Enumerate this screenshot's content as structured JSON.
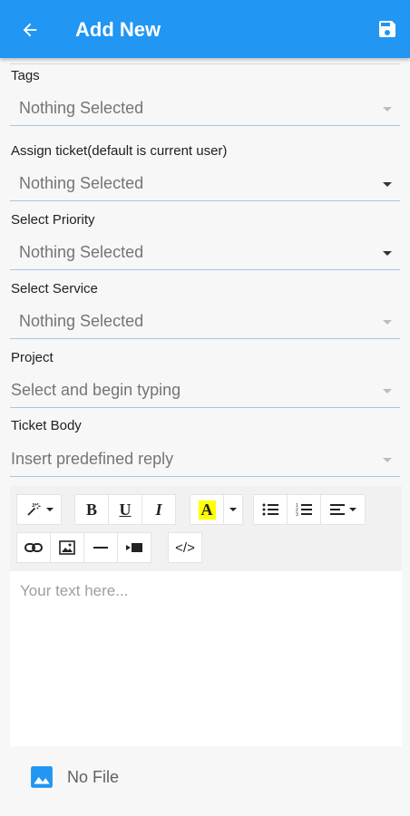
{
  "header": {
    "title": "Add New"
  },
  "fields": {
    "tags": {
      "label": "Tags",
      "value": "Nothing Selected"
    },
    "assign": {
      "label": "Assign ticket(default is current user)",
      "value": "Nothing Selected"
    },
    "priority": {
      "label": "Select Priority",
      "value": "Nothing Selected"
    },
    "service": {
      "label": "Select Service",
      "value": "Nothing Selected"
    },
    "project": {
      "label": "Project",
      "value": "Select and begin typing"
    },
    "ticket_body": {
      "label": "Ticket Body",
      "value": "Insert predefined reply"
    }
  },
  "editor": {
    "toolbar": {
      "bold": "B",
      "underline": "U",
      "italic": "I",
      "highlight": "A",
      "code": "</>"
    },
    "placeholder": "Your text here..."
  },
  "attachment": {
    "label": "No File"
  },
  "colors": {
    "primary": "#2196f3",
    "highlight": "#ffff00"
  }
}
